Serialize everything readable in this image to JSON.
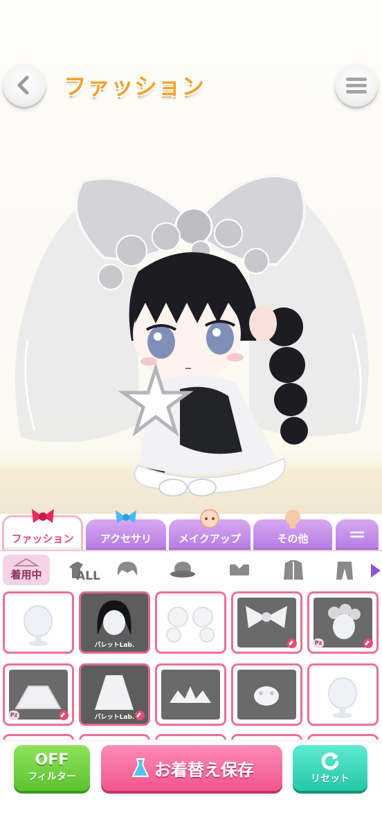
{
  "header": {
    "title": "ファッション",
    "back_icon": "chevron-left-icon",
    "menu_icon": "hamburger-menu-icon"
  },
  "tabs": [
    {
      "label": "ファッション",
      "active": true
    },
    {
      "label": "アクセサリ",
      "active": false
    },
    {
      "label": "メイクアップ",
      "active": false
    },
    {
      "label": "その他",
      "active": false
    },
    {
      "label": "＝",
      "active": false
    }
  ],
  "categories": {
    "worn_label": "着用中",
    "all_label": "ALL"
  },
  "grid": {
    "items": [
      {
        "brand": "",
        "dark": false
      },
      {
        "brand": "パレットLab.",
        "dark": true
      },
      {
        "brand": "",
        "dark": false
      },
      {
        "brand": "",
        "dark": false
      },
      {
        "brand": "",
        "dark": false
      },
      {
        "brand": "",
        "dark": false
      },
      {
        "brand": "パレットLab.",
        "dark": true
      },
      {
        "brand": "",
        "dark": false
      },
      {
        "brand": "",
        "dark": false
      },
      {
        "brand": "",
        "dark": false
      }
    ]
  },
  "bottom": {
    "filter_state": "OFF",
    "filter_label": "フィルター",
    "save_label": "お着替え保存",
    "reset_label": "リセット"
  },
  "colors": {
    "accent_pink": "#f0568d",
    "title_orange": "#f3a22b",
    "tab_purple": "#b67be4",
    "filter_green": "#5cc32f",
    "reset_teal": "#25c8a5"
  }
}
